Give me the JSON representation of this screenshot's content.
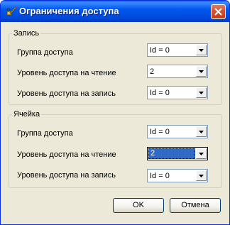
{
  "window": {
    "title": "Ограничения доступа"
  },
  "groups": [
    {
      "legend": "Запись",
      "rows": [
        {
          "label": "Группа доступа",
          "value": "Id = 0"
        },
        {
          "label": "Уровень доступа на чтение",
          "value": "2"
        },
        {
          "label": "Уровень доступа на запись",
          "value": "Id = 0"
        }
      ]
    },
    {
      "legend": "Ячейка",
      "rows": [
        {
          "label": "Группа доступа",
          "value": "Id = 0"
        },
        {
          "label": "Уровень доступа на чтение",
          "value": "2"
        },
        {
          "label": "Уровень доступа на запись",
          "value": "Id = 0"
        }
      ]
    }
  ],
  "buttons": {
    "ok": "OK",
    "cancel": "Отмена"
  },
  "icons": {
    "title": "pencil-key-icon",
    "close": "close-icon",
    "dropdown": "chevron-down-icon"
  },
  "colors": {
    "titlebar": "#0058ee",
    "face": "#ece9d8",
    "selection": "#316ac5",
    "close": "#d2502e"
  }
}
